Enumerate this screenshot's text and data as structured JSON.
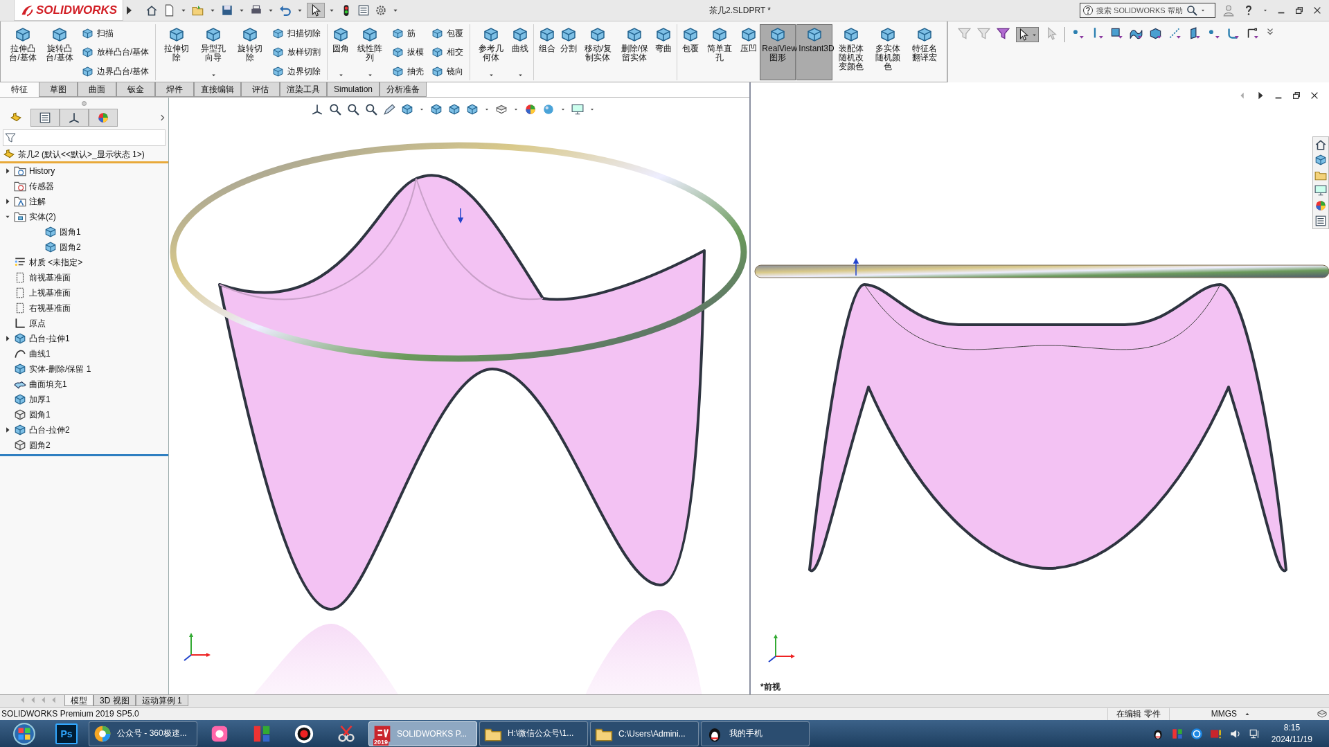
{
  "title_bar": {
    "logo": "SOLIDWORKS",
    "document_title": "茶几2.SLDPRT *",
    "search_placeholder": "搜索 SOLIDWORKS 帮助"
  },
  "command_groups": [
    {
      "commands": [
        {
          "kind": "large",
          "label": "拉伸凸台/基体",
          "dropdown": false,
          "pressed": false
        },
        {
          "kind": "large",
          "label": "旋转凸台/基体",
          "dropdown": false,
          "pressed": false
        },
        {
          "kind": "stack",
          "labels": [
            "扫描",
            "放样凸台/基体",
            "边界凸台/基体"
          ]
        }
      ]
    },
    {
      "commands": [
        {
          "kind": "large",
          "label": "拉伸切除",
          "dropdown": false,
          "pressed": false
        },
        {
          "kind": "large",
          "label": "异型孔向导",
          "dropdown": true,
          "pressed": false
        },
        {
          "kind": "large",
          "label": "旋转切除",
          "dropdown": false,
          "pressed": false
        },
        {
          "kind": "stack",
          "labels": [
            "扫描切除",
            "放样切割",
            "边界切除"
          ]
        }
      ]
    },
    {
      "commands": [
        {
          "kind": "large",
          "label": "圆角",
          "dropdown": true,
          "pressed": false
        },
        {
          "kind": "large",
          "label": "线性阵列",
          "dropdown": true,
          "pressed": false
        },
        {
          "kind": "stack",
          "labels": [
            "筋",
            "拔模",
            "抽壳"
          ]
        },
        {
          "kind": "stack",
          "labels": [
            "包覆",
            "相交",
            "镜向"
          ]
        }
      ]
    },
    {
      "commands": [
        {
          "kind": "large",
          "label": "参考几何体",
          "dropdown": true,
          "pressed": false
        },
        {
          "kind": "large",
          "label": "曲线",
          "dropdown": true,
          "pressed": false
        }
      ]
    },
    {
      "commands": [
        {
          "kind": "large",
          "label": "组合",
          "dropdown": false,
          "pressed": false
        },
        {
          "kind": "large",
          "label": "分割",
          "dropdown": false,
          "pressed": false
        },
        {
          "kind": "large",
          "label": "移动/复制实体",
          "dropdown": false,
          "pressed": false
        },
        {
          "kind": "large",
          "label": "删除/保留实体",
          "dropdown": false,
          "pressed": false
        },
        {
          "kind": "large",
          "label": "弯曲",
          "dropdown": false,
          "pressed": false
        }
      ]
    },
    {
      "commands": [
        {
          "kind": "large",
          "label": "包覆",
          "dropdown": false,
          "pressed": false
        },
        {
          "kind": "large",
          "label": "简单直孔",
          "dropdown": false,
          "pressed": false
        },
        {
          "kind": "large",
          "label": "压凹",
          "dropdown": false,
          "pressed": false
        },
        {
          "kind": "large",
          "label": "RealView图形",
          "dropdown": false,
          "pressed": true
        },
        {
          "kind": "large",
          "label": "Instant3D",
          "dropdown": false,
          "pressed": true
        },
        {
          "kind": "large",
          "label": "装配体随机改变颜色",
          "dropdown": false,
          "pressed": false
        },
        {
          "kind": "large",
          "label": "多实体随机颜色",
          "dropdown": false,
          "pressed": false
        },
        {
          "kind": "large",
          "label": "特征名翻译宏",
          "dropdown": false,
          "pressed": false
        }
      ]
    }
  ],
  "tabs": [
    {
      "label": "特征",
      "selected": true
    },
    {
      "label": "草图",
      "selected": false
    },
    {
      "label": "曲面",
      "selected": false
    },
    {
      "label": "钣金",
      "selected": false
    },
    {
      "label": "焊件",
      "selected": false
    },
    {
      "label": "直接编辑",
      "selected": false
    },
    {
      "label": "评估",
      "selected": false
    },
    {
      "label": "渲染工具",
      "selected": false
    },
    {
      "label": "Simulation",
      "selected": false
    },
    {
      "label": "分析准备",
      "selected": false
    }
  ],
  "feature_tree": {
    "root": "茶几2 (默认<<默认>_显示状态 1>)",
    "items": [
      {
        "label": "History",
        "kind": "history",
        "expandable": true,
        "expanded": false
      },
      {
        "label": "传感器",
        "kind": "sensor",
        "expandable": false
      },
      {
        "label": "注解",
        "kind": "annotation",
        "expandable": true,
        "expanded": false
      },
      {
        "label": "实体(2)",
        "kind": "solid-folder",
        "expandable": true,
        "expanded": true,
        "children": [
          {
            "label": "圆角1",
            "kind": "body",
            "expandable": false
          },
          {
            "label": "圆角2",
            "kind": "body",
            "expandable": false
          }
        ]
      },
      {
        "label": "材质 <未指定>",
        "kind": "material",
        "expandable": false
      },
      {
        "label": "前视基准面",
        "kind": "plane",
        "expandable": false
      },
      {
        "label": "上视基准面",
        "kind": "plane",
        "expandable": false
      },
      {
        "label": "右视基准面",
        "kind": "plane",
        "expandable": false
      },
      {
        "label": "原点",
        "kind": "origin",
        "expandable": false
      },
      {
        "label": "凸台-拉伸1",
        "kind": "extrude",
        "expandable": true,
        "expanded": false
      },
      {
        "label": "曲线1",
        "kind": "curve",
        "expandable": false
      },
      {
        "label": "实体-删除/保留 1",
        "kind": "delete-body",
        "expandable": false
      },
      {
        "label": "曲面填充1",
        "kind": "surface",
        "expandable": false
      },
      {
        "label": "加厚1",
        "kind": "thicken",
        "expandable": false
      },
      {
        "label": "圆角1",
        "kind": "fillet",
        "expandable": false
      },
      {
        "label": "凸台-拉伸2",
        "kind": "extrude",
        "expandable": true,
        "expanded": false
      },
      {
        "label": "圆角2",
        "kind": "fillet",
        "expandable": false
      }
    ]
  },
  "panel_tabs": [
    {
      "selected": true
    },
    {
      "selected": false
    },
    {
      "selected": false
    },
    {
      "selected": false
    }
  ],
  "right_viewport": {
    "view_label": "*前视"
  },
  "model_tabs": [
    {
      "label": "模型",
      "selected": true
    },
    {
      "label": "3D 视图",
      "selected": false
    },
    {
      "label": "运动算例 1",
      "selected": false
    }
  ],
  "status_bar": {
    "product": "SOLIDWORKS Premium 2019 SP5.0",
    "mode": "在编辑 零件",
    "units": "MMGS"
  },
  "taskbar": {
    "items": [
      {
        "kind": "pinned",
        "label": "Ps"
      },
      {
        "kind": "browser",
        "label": "公众号 - 360极速...",
        "selected": false
      },
      {
        "kind": "cad",
        "label": "SOLIDWORKS P...",
        "badge": "2019",
        "selected": true
      },
      {
        "kind": "folder",
        "label": "H:\\微信公众号\\1...",
        "selected": false
      },
      {
        "kind": "folder",
        "label": "C:\\Users\\Admini...",
        "selected": false
      },
      {
        "kind": "chat",
        "label": "我的手机",
        "selected": false
      }
    ],
    "time": "8:15",
    "date": "2024/11/19"
  }
}
